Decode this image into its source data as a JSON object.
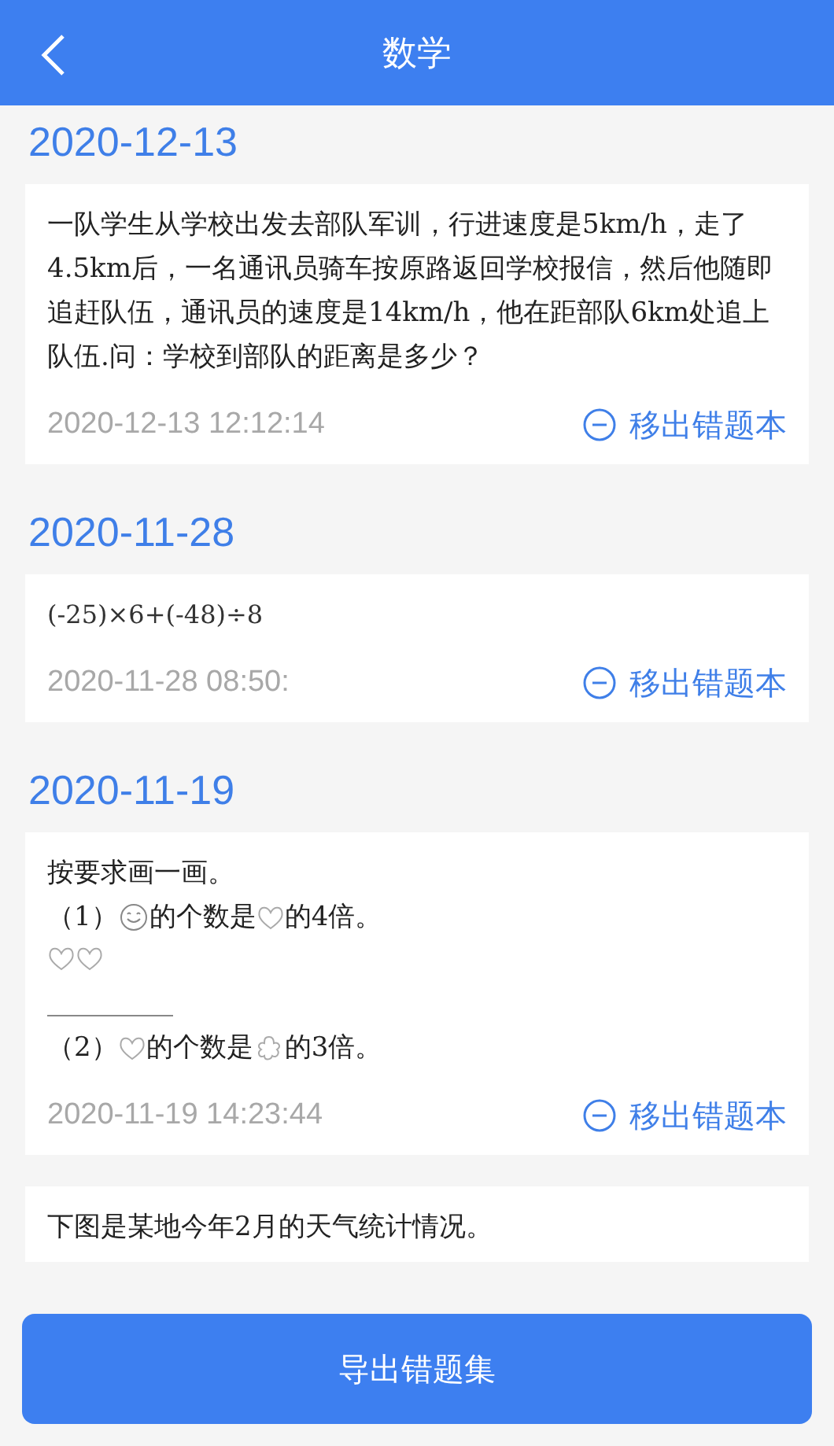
{
  "header": {
    "title": "数学"
  },
  "groups": [
    {
      "date": "2020-12-13",
      "cards": [
        {
          "lines": [
            [
              {
                "kind": "text",
                "text": "一队学生从学校出发去部队军训，行进速度是5km/h，走了4.5km后，一名通讯员骑车按原路返回学校报信，然后他随即追赶队伍，通讯员的速度是14km/h，他在距部队6km处追上队伍.问：学校到部队的距离是多少？"
              }
            ]
          ],
          "time": "2020-12-13 12:12:14",
          "action": "移出错题本"
        }
      ]
    },
    {
      "date": "2020-11-28",
      "cards": [
        {
          "lines": [
            [
              {
                "kind": "math",
                "text": "(-25)×6+(-48)÷8"
              }
            ]
          ],
          "time": "2020-11-28 08:50:",
          "action": "移出错题本"
        }
      ]
    },
    {
      "date": "2020-11-19",
      "cards": [
        {
          "lines": [
            [
              {
                "kind": "text",
                "text": "按要求画一画。"
              }
            ],
            [
              {
                "kind": "text",
                "text": "（1）"
              },
              {
                "kind": "smiley"
              },
              {
                "kind": "text",
                "text": "的个数是"
              },
              {
                "kind": "heart"
              },
              {
                "kind": "text",
                "text": "的4倍。"
              }
            ],
            [
              {
                "kind": "heart"
              },
              {
                "kind": "heart"
              }
            ],
            [
              {
                "kind": "blank"
              }
            ],
            [
              {
                "kind": "text",
                "text": "（2）"
              },
              {
                "kind": "heart"
              },
              {
                "kind": "text",
                "text": "的个数是"
              },
              {
                "kind": "flower"
              },
              {
                "kind": "text",
                "text": "的3倍。"
              }
            ]
          ],
          "time": "2020-11-19 14:23:44",
          "action": "移出错题本"
        },
        {
          "lines": [
            [
              {
                "kind": "text",
                "text": "下图是某地今年2月的天气统计情况。"
              }
            ]
          ]
        }
      ]
    }
  ],
  "export_button": "导出错题集"
}
